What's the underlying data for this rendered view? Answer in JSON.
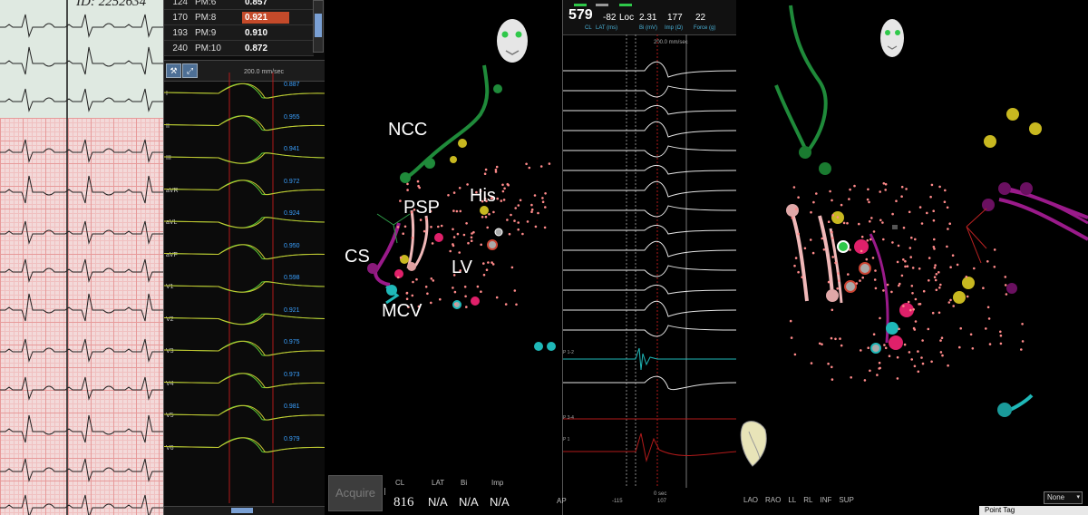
{
  "paper": {
    "id_text": "ID: 2252634"
  },
  "pm_table": {
    "rows": [
      {
        "num": "124",
        "name": "PM:6",
        "score": "0.857",
        "selected": false
      },
      {
        "num": "170",
        "name": "PM:8",
        "score": "0.921",
        "selected": true
      },
      {
        "num": "193",
        "name": "PM:9",
        "score": "0.910",
        "selected": false
      },
      {
        "num": "240",
        "name": "PM:10",
        "score": "0.872",
        "selected": false
      }
    ]
  },
  "signals": {
    "scale_label": "200.0 mm/sec",
    "leads": [
      {
        "lead": "I",
        "value": "0.887"
      },
      {
        "lead": "II",
        "value": "0.955"
      },
      {
        "lead": "III",
        "value": "0.941"
      },
      {
        "lead": "aVR",
        "value": "0.972"
      },
      {
        "lead": "aVL",
        "value": "0.924"
      },
      {
        "lead": "aVF",
        "value": "0.950"
      },
      {
        "lead": "V1",
        "value": "0.598"
      },
      {
        "lead": "V2",
        "value": "0.921"
      },
      {
        "lead": "V3",
        "value": "0.975"
      },
      {
        "lead": "V4",
        "value": "0.973"
      },
      {
        "lead": "V5",
        "value": "0.981"
      },
      {
        "lead": "V6",
        "value": "0.979"
      }
    ]
  },
  "map1": {
    "labels": {
      "ncc": "NCC",
      "psp": "PSP",
      "his": "His",
      "cs": "CS",
      "lv": "LV",
      "mcv": "MCV"
    },
    "acquire_label": "Acquire",
    "status": {
      "cl_label": "CL",
      "lat_label": "LAT",
      "bi_label": "Bi",
      "imp_label": "Imp",
      "cl_value": "816",
      "lat_value": "N/A",
      "bi_value": "N/A",
      "imp_value": "N/A"
    },
    "colors": {
      "ncc": "#1f8a3a",
      "cs": "#9a1a8a",
      "psp": "#f0b8b8",
      "his": "#c8b820",
      "mcv": "#1fb8b8",
      "points": "#ff8a8a"
    }
  },
  "egm": {
    "header": {
      "cl_value": "579",
      "lat_value": "-82",
      "loc_label": "Loc",
      "bi_value": "2.31",
      "imp_value": "177",
      "force_value": "22",
      "cl_label": "CL",
      "lat_label": "LAT (ms)",
      "bi_label": "Bi (mV)",
      "imp_label": "Imp (Ω)",
      "force_label": "Force (g)"
    },
    "scale_label": "200.0 mm/sec",
    "channel_labels": {
      "c1": "P 1-2",
      "c2": "P 3-4",
      "c3": "P 1"
    },
    "footer": {
      "left": "-115",
      "mid": "0 sec",
      "right": "107"
    }
  },
  "map2": {
    "views": [
      "LAO",
      "RAO",
      "LL",
      "RL",
      "INF",
      "SUP"
    ],
    "left_trunc": "AP",
    "view_partial": "A",
    "select_value": "None",
    "tooltip_text": "Point Tag"
  }
}
